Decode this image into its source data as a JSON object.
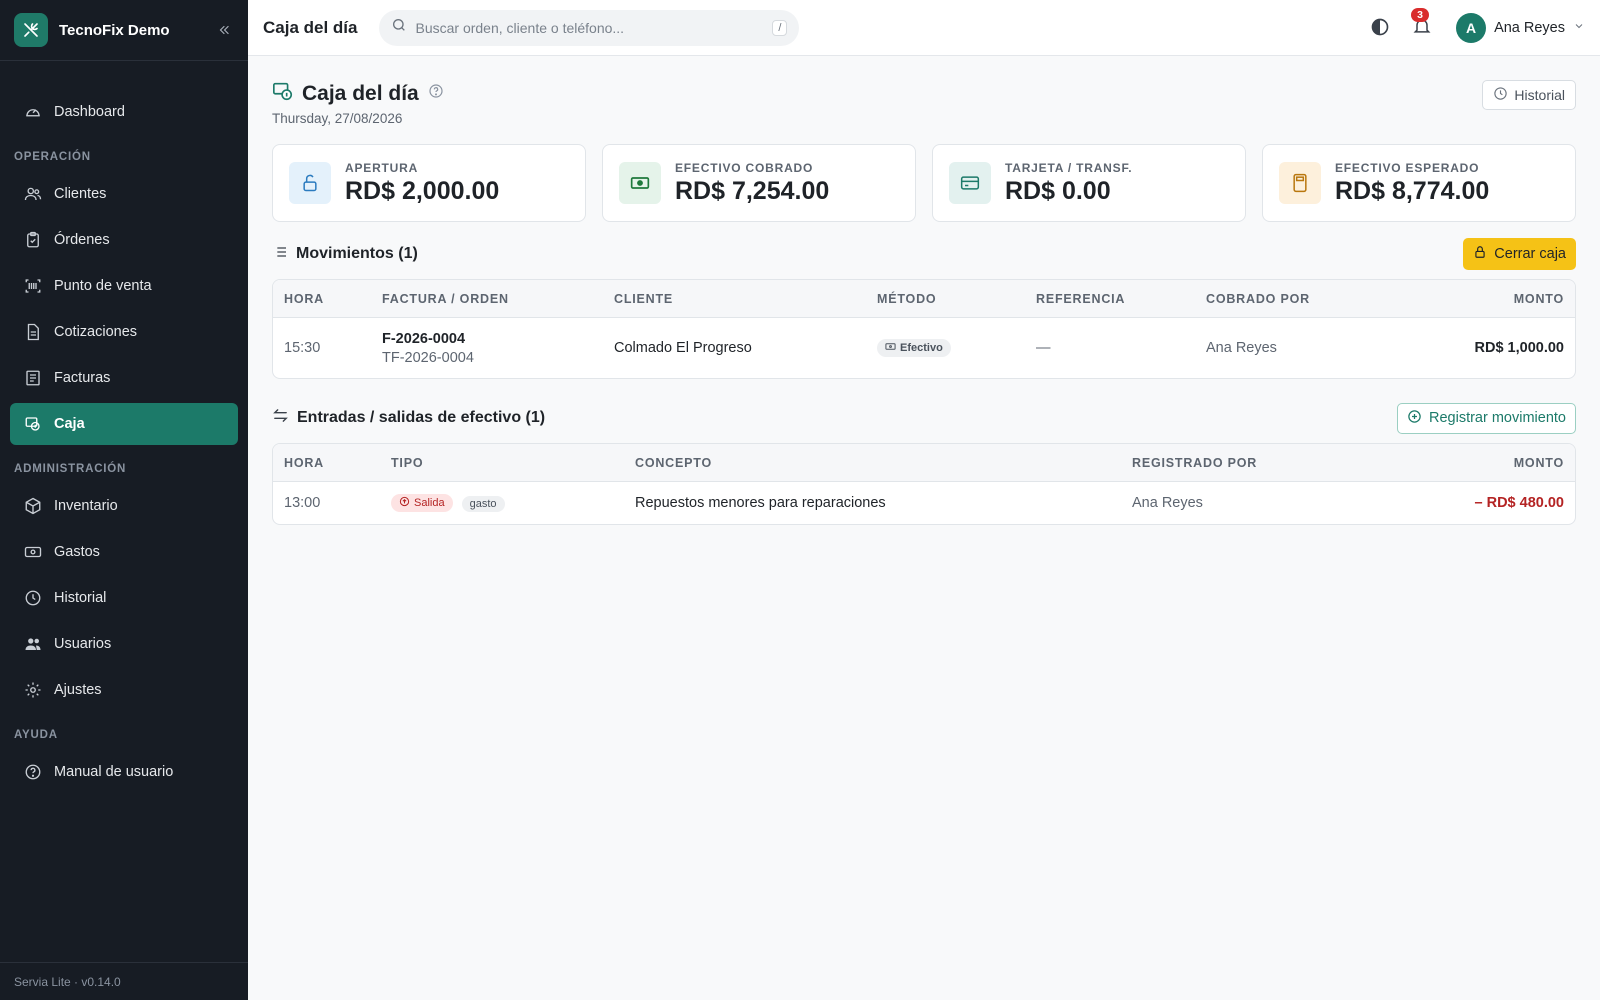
{
  "brand": {
    "name": "TecnoFix Demo"
  },
  "sidebar": {
    "items_top": [
      {
        "label": "Dashboard",
        "icon": "gauge-icon"
      }
    ],
    "section_operacion": "OPERACIÓN",
    "items_operacion": [
      {
        "label": "Clientes"
      },
      {
        "label": "Órdenes"
      },
      {
        "label": "Punto de venta"
      },
      {
        "label": "Cotizaciones"
      },
      {
        "label": "Facturas"
      },
      {
        "label": "Caja"
      }
    ],
    "section_admin": "ADMINISTRACIÓN",
    "items_admin": [
      {
        "label": "Inventario"
      },
      {
        "label": "Gastos"
      },
      {
        "label": "Historial"
      },
      {
        "label": "Usuarios"
      },
      {
        "label": "Ajustes"
      }
    ],
    "section_ayuda": "AYUDA",
    "items_ayuda": [
      {
        "label": "Manual de usuario"
      }
    ],
    "footer": "Servia Lite · v0.14.0"
  },
  "topbar": {
    "title": "Caja del día",
    "search_placeholder": "Buscar orden, cliente o teléfono...",
    "search_shortcut": "/",
    "notifications": "3",
    "avatar_initial": "A",
    "user_name": "Ana Reyes"
  },
  "page": {
    "title": "Caja del día",
    "date": "Thursday, 27/08/2026",
    "history_button": "Historial"
  },
  "cards": [
    {
      "label": "APERTURA",
      "value": "RD$ 2,000.00"
    },
    {
      "label": "EFECTIVO COBRADO",
      "value": "RD$ 7,254.00"
    },
    {
      "label": "TARJETA / TRANSF.",
      "value": "RD$ 0.00"
    },
    {
      "label": "EFECTIVO ESPERADO",
      "value": "RD$ 8,774.00"
    }
  ],
  "movements": {
    "title": "Movimientos (1)",
    "close_button": "Cerrar caja",
    "headers": [
      "HORA",
      "FACTURA / ORDEN",
      "CLIENTE",
      "MÉTODO",
      "REFERENCIA",
      "COBRADO POR",
      "MONTO"
    ],
    "rows": [
      {
        "hora": "15:30",
        "factura": "F-2026-0004",
        "orden": "TF-2026-0004",
        "cliente": "Colmado El Progreso",
        "metodo": "Efectivo",
        "referencia": "—",
        "cobrado_por": "Ana Reyes",
        "monto": "RD$ 1,000.00"
      }
    ]
  },
  "cash_flow": {
    "title": "Entradas / salidas de efectivo (1)",
    "register_button": "Registrar movimiento",
    "headers": [
      "HORA",
      "TIPO",
      "CONCEPTO",
      "REGISTRADO POR",
      "MONTO"
    ],
    "rows": [
      {
        "hora": "13:00",
        "tipo": "Salida",
        "tag": "gasto",
        "concepto": "Repuestos menores para reparaciones",
        "registrado_por": "Ana Reyes",
        "monto": "– RD$ 480.00"
      }
    ]
  },
  "colors": {
    "accent": "#1c7a69",
    "sidebar_bg": "#171c24",
    "warning": "#f5c216",
    "danger": "#b42323"
  }
}
